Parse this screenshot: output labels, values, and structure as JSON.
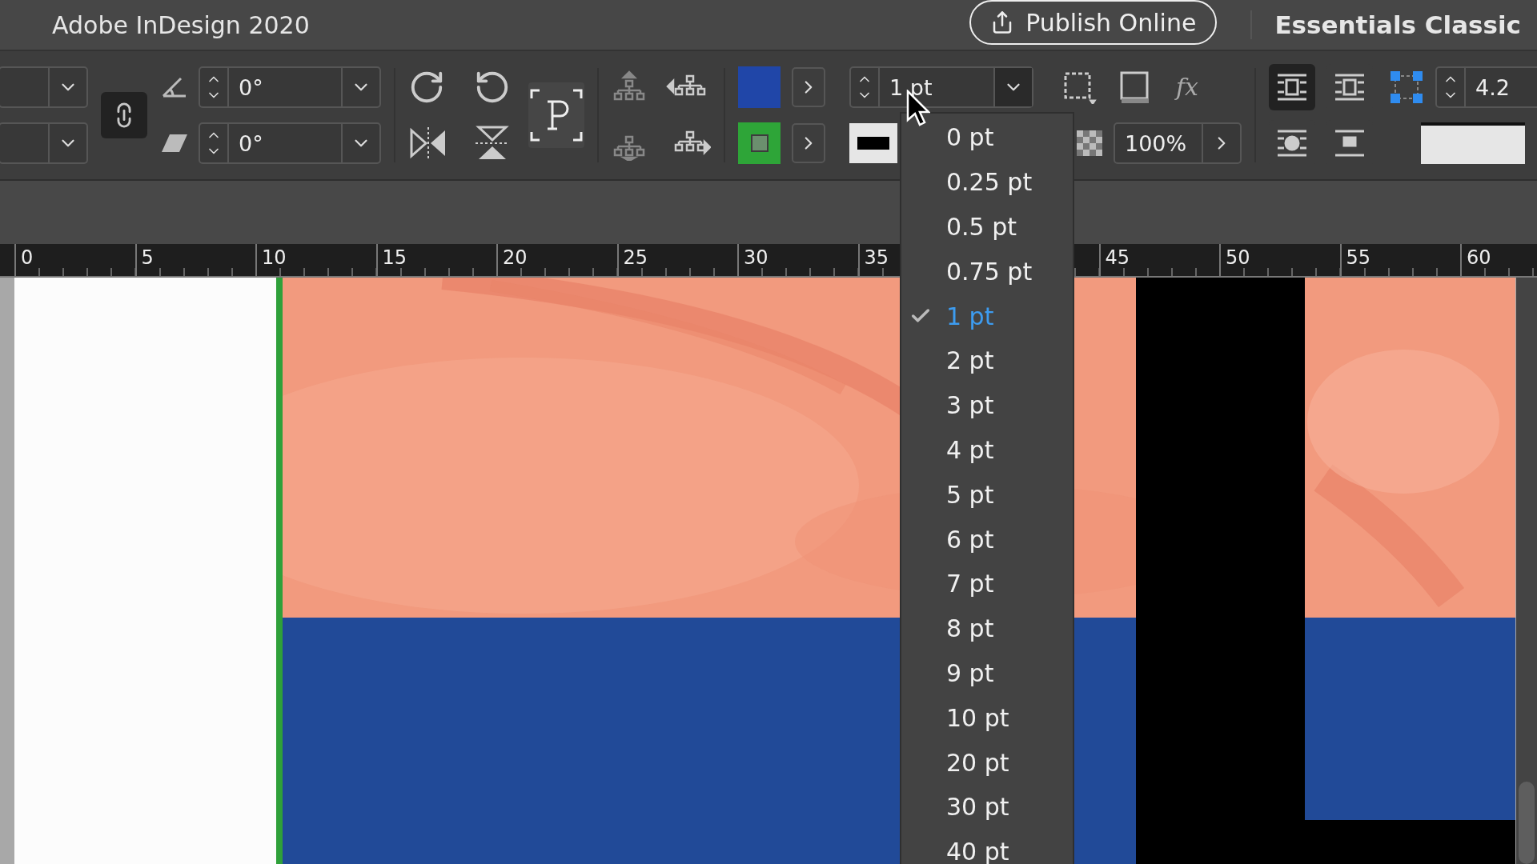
{
  "title_bar": {
    "app_title": "Adobe InDesign 2020",
    "publish_button": "Publish Online",
    "workspace": "Essentials Classic"
  },
  "control_panel": {
    "rotation_angle": "0°",
    "shear_angle": "0°",
    "stroke_weight": "1 pt",
    "opacity": "100%",
    "offset_value": "4.2",
    "effects_button": "fx",
    "text_wrap": [
      {
        "selected": true
      },
      {
        "selected": false
      },
      {
        "selected": false
      },
      {
        "selected": false
      }
    ]
  },
  "stroke_menu": {
    "items": [
      {
        "label": "0 pt",
        "selected": false
      },
      {
        "label": "0.25 pt",
        "selected": false
      },
      {
        "label": "0.5 pt",
        "selected": false
      },
      {
        "label": "0.75 pt",
        "selected": false
      },
      {
        "label": "1 pt",
        "selected": true
      },
      {
        "label": "2 pt",
        "selected": false
      },
      {
        "label": "3 pt",
        "selected": false
      },
      {
        "label": "4 pt",
        "selected": false
      },
      {
        "label": "5 pt",
        "selected": false
      },
      {
        "label": "6 pt",
        "selected": false
      },
      {
        "label": "7 pt",
        "selected": false
      },
      {
        "label": "8 pt",
        "selected": false
      },
      {
        "label": "9 pt",
        "selected": false
      },
      {
        "label": "10 pt",
        "selected": false
      },
      {
        "label": "20 pt",
        "selected": false
      },
      {
        "label": "30 pt",
        "selected": false
      },
      {
        "label": "40 pt",
        "selected": false
      }
    ]
  },
  "ruler": {
    "segments": [
      {
        "label": "0"
      },
      {
        "label": "5"
      },
      {
        "label": "10"
      },
      {
        "label": "15"
      },
      {
        "label": "20"
      },
      {
        "label": "25"
      },
      {
        "label": "30"
      },
      {
        "label": "35"
      },
      {
        "label": "45"
      },
      {
        "label": "50"
      },
      {
        "label": "55"
      },
      {
        "label": "60"
      }
    ]
  }
}
